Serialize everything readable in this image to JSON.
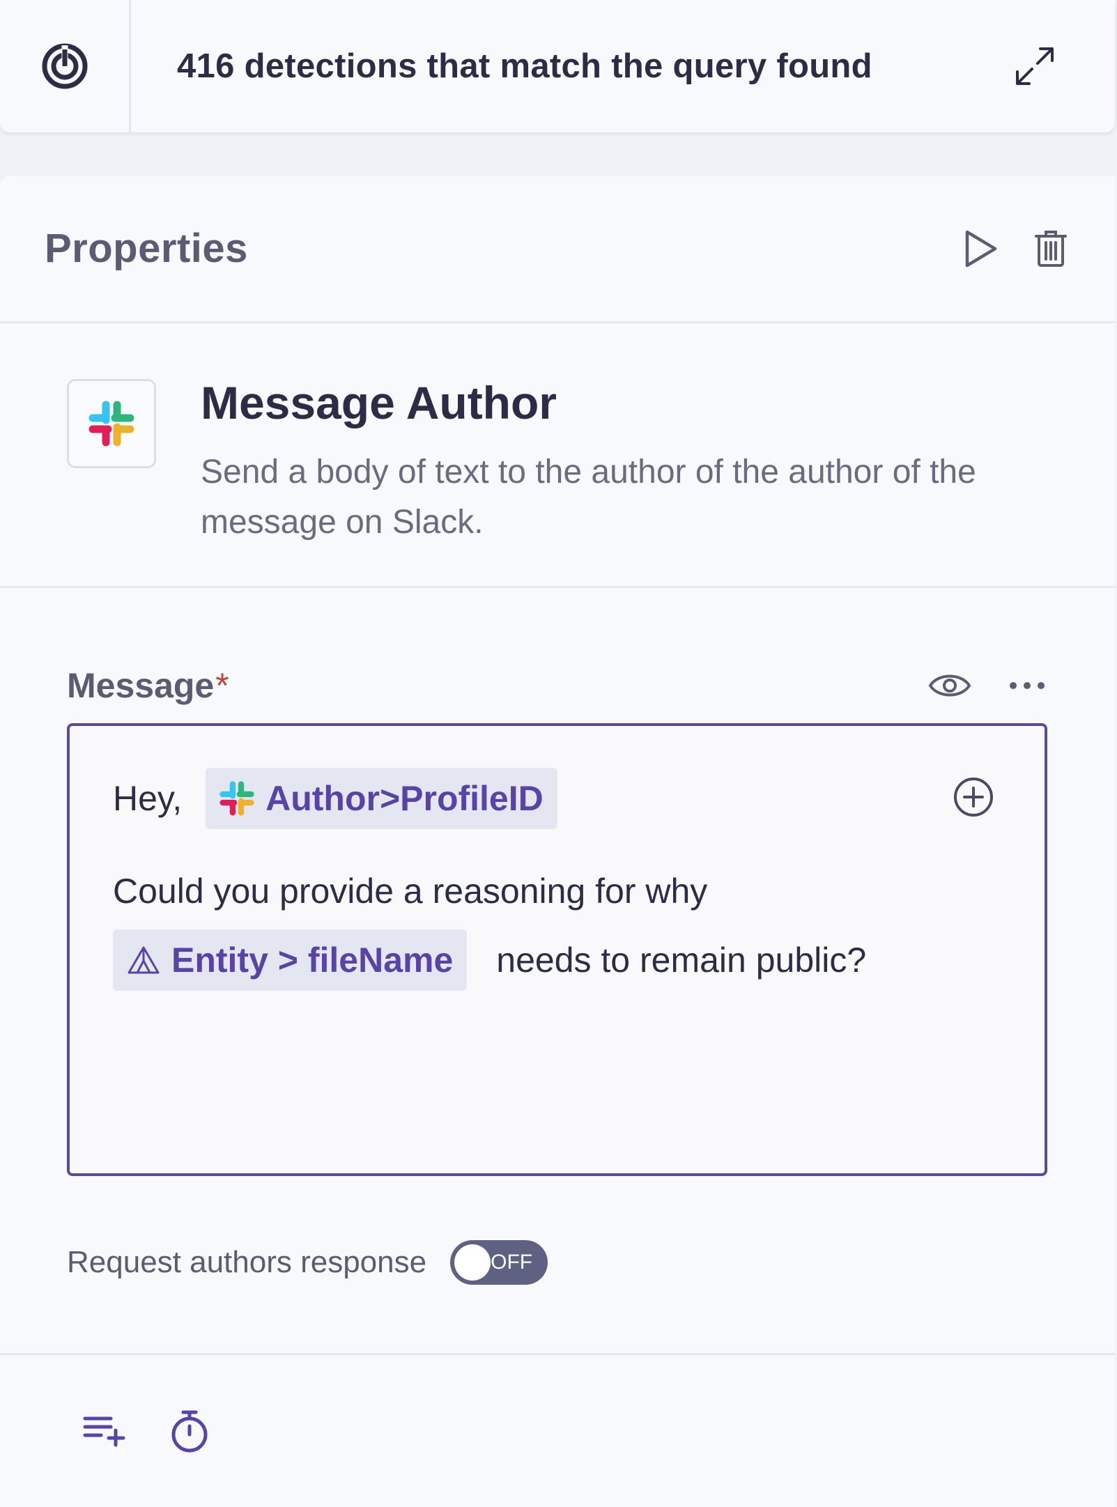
{
  "topbar": {
    "title": "416 detections that match the query found",
    "logo_icon": "target-logo-icon",
    "expand_icon": "expand-icon"
  },
  "properties": {
    "title": "Properties",
    "run_icon": "play-icon",
    "delete_icon": "trash-icon"
  },
  "action": {
    "app_icon": "slack-icon",
    "title": "Message Author",
    "description": "Send a body of text to the author of the author of the message on Slack."
  },
  "message_field": {
    "label": "Message",
    "required_mark": "*",
    "preview_icon": "eye-icon",
    "more_icon": "more-horizontal-icon",
    "greeting": "Hey,",
    "author_chip": "Author>ProfileID",
    "body_line": "Could you provide a reasoning for why",
    "entity_chip": "Entity > fileName",
    "after_entity": "needs to remain public?",
    "add_icon": "plus-circle-icon"
  },
  "request_response": {
    "label": "Request authors response",
    "state": "OFF"
  },
  "footer": {
    "add_list_icon": "add-list-icon",
    "timer_icon": "stopwatch-icon"
  },
  "colors": {
    "accent": "#5a43a6",
    "border_accent": "#5b4a9c",
    "required": "#c0443e",
    "toggle_off": "#5e6182"
  }
}
